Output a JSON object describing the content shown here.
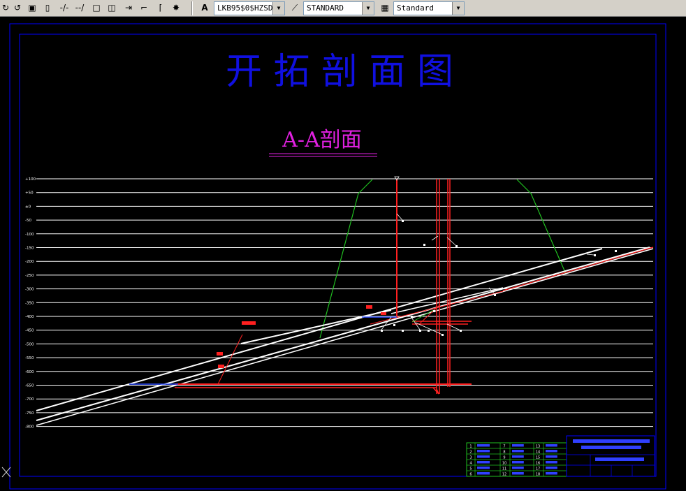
{
  "toolbar": {
    "icons": [
      "redo-icon",
      "window-icon",
      "ruler-icon",
      "break-icon",
      "extend-icon",
      "rectangle-icon",
      "rectangle-open-icon",
      "join-icon",
      "fillet-icon",
      "chamfer-icon",
      "explode-icon"
    ],
    "text_style_value": "LKB95$0$HZSD",
    "dim_style_value": "STANDARD",
    "table_style_value": "Standard"
  },
  "drawing": {
    "title": "开 拓 剖 面 图",
    "subtitle": "A-A剖面",
    "elevation_labels": [
      "+100",
      "+50",
      "±0",
      "-50",
      "-100",
      "-150",
      "-200",
      "-250",
      "-300",
      "-350",
      "-400",
      "-450",
      "-500",
      "-550",
      "-600",
      "-650",
      "-700",
      "-750",
      "-800"
    ],
    "title_block": {
      "row_numbers": [
        "1",
        "2",
        "3",
        "4",
        "5",
        "6"
      ],
      "row_numbers_2": [
        "7",
        "8",
        "9",
        "10",
        "11",
        "12"
      ],
      "row_numbers_3": [
        "13",
        "14",
        "15",
        "16",
        "17",
        "18"
      ]
    }
  },
  "colors": {
    "background": "#000000",
    "border": "#0000ff",
    "title": "#1010e0",
    "subtitle": "#e020e0",
    "levels": "#ffffff",
    "roadway": "#ffffff",
    "shaft": "#ff2020",
    "outcrop": "#20c020",
    "title_block_grid": "#20c020"
  }
}
